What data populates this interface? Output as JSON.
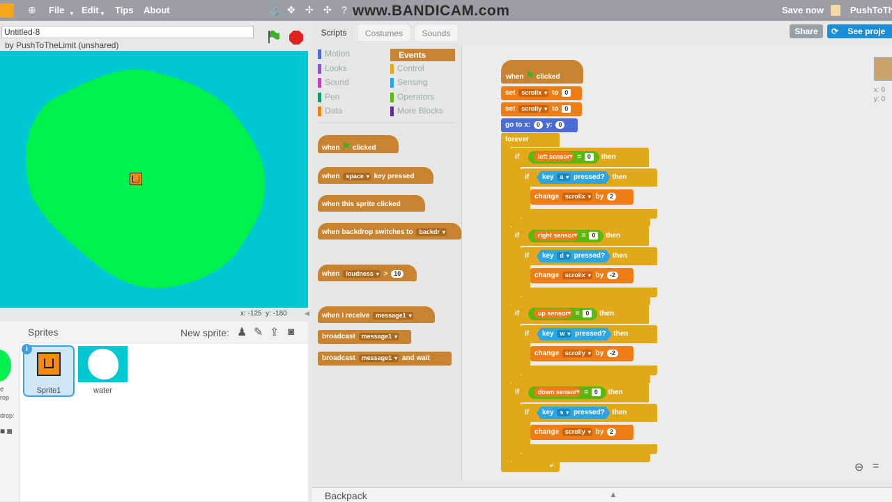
{
  "menu": {
    "file": "File",
    "edit": "Edit",
    "tips": "Tips",
    "about": "About",
    "save_now": "Save now",
    "user": "PushToTh"
  },
  "watermark": "www.BANDICAM.com",
  "project": {
    "title": "Untitled-8",
    "byline": "by PushToTheLimit (unshared)"
  },
  "stage": {
    "coords_x": "x: -125",
    "coords_y": "y: -180"
  },
  "sprites": {
    "header": "Sprites",
    "new_sprite": "New sprite:",
    "items": [
      "Sprite1",
      "water"
    ],
    "partial_label_1": "e",
    "partial_label_2": "rop",
    "partial_label_3": "drop:"
  },
  "tabs": {
    "scripts": "Scripts",
    "costumes": "Costumes",
    "sounds": "Sounds"
  },
  "actions": {
    "share": "Share",
    "see_project": "See proje"
  },
  "categories": {
    "left": [
      "Motion",
      "Looks",
      "Sound",
      "Pen",
      "Data"
    ],
    "right": [
      "Events",
      "Control",
      "Sensing",
      "Operators",
      "More Blocks"
    ],
    "selected": "Events"
  },
  "colors": {
    "motion": "#4a6cd4",
    "looks": "#8a55d7",
    "sound": "#bb42c3",
    "pen": "#0e9a6c",
    "data": "#ee7d16",
    "events": "#c88330",
    "control": "#e1a91a",
    "sensing": "#2ca5e2",
    "operators": "#5cb712",
    "more": "#632d99",
    "stage_bg": "#00c8d2",
    "island": "#00f04e"
  },
  "palette": {
    "when": "when",
    "clicked": "clicked",
    "space": "space",
    "key_pressed": "key pressed",
    "sprite_clicked": "when this sprite clicked",
    "backdrop_switches": "when backdrop switches to",
    "backdrop_field": "backdr",
    "loudness": "loudness",
    "gt": ">",
    "ten": "10",
    "when_receive": "when I receive",
    "message1": "message1",
    "broadcast": "broadcast",
    "and_wait": "and wait"
  },
  "script": {
    "when": "when",
    "clicked": "clicked",
    "set": "set",
    "to": "to",
    "scrollx": "scrollx",
    "scrolly": "scrolly",
    "zero": "0",
    "goto": "go to x:",
    "y": "y:",
    "forever": "forever",
    "if": "if",
    "then": "then",
    "eq": "=",
    "left_sensor": "left sensor",
    "right_sensor": "right sensor",
    "up_sensor": "up sensor",
    "down_sensor": "down sensor",
    "key": "key",
    "pressed": "pressed?",
    "a": "a",
    "d": "d",
    "w": "w",
    "s": "s",
    "change": "change",
    "by": "by",
    "two": "2",
    "neg_two": "-2"
  },
  "sprite_info": {
    "x": "x: 0",
    "y": "y: 0"
  },
  "backpack": "Backpack"
}
